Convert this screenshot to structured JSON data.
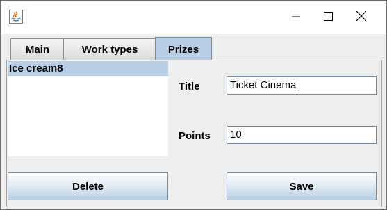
{
  "window": {
    "app_icon": "java-icon",
    "controls": {
      "minimize": "–",
      "maximize": "☐",
      "close": "✕"
    }
  },
  "tabs": [
    {
      "label": "Main",
      "selected": false
    },
    {
      "label": "Work types",
      "selected": false
    },
    {
      "label": "Prizes",
      "selected": true
    }
  ],
  "prizes_list": {
    "items": [
      {
        "label": "Ice cream8",
        "selected": true
      }
    ]
  },
  "form": {
    "title_label": "Title",
    "title_value": "Ticket Cinema",
    "points_label": "Points",
    "points_value": "10"
  },
  "buttons": {
    "delete_label": "Delete",
    "save_label": "Save"
  },
  "colors": {
    "selection": "#b9cfe5",
    "panel_bg": "#eeeeee"
  }
}
